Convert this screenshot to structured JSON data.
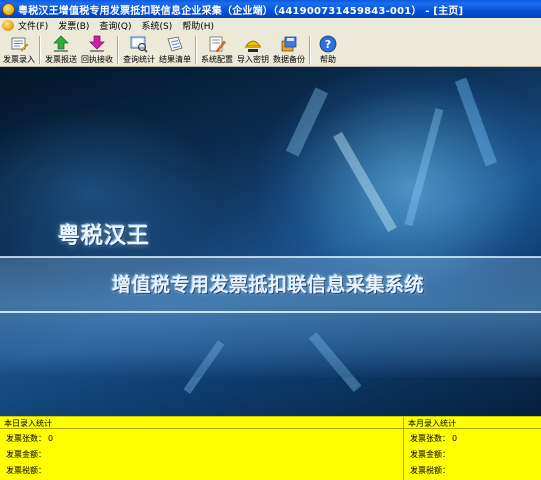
{
  "window": {
    "title": "粤税汉王增值税专用发票抵扣联信息企业采集（企业端）（441900731459843-001） - [主页]"
  },
  "menu": [
    {
      "label": "文件(F)"
    },
    {
      "label": "发票(B)"
    },
    {
      "label": "查询(Q)"
    },
    {
      "label": "系统(S)"
    },
    {
      "label": "帮助(H)"
    }
  ],
  "toolbar": [
    {
      "label": "发票录入",
      "icon": "invoice-entry-icon"
    },
    {
      "label": "发票报送",
      "icon": "upload-arrow-icon"
    },
    {
      "label": "回执接收",
      "icon": "download-arrow-icon"
    },
    {
      "label": "查询统计",
      "icon": "query-stats-icon"
    },
    {
      "label": "结果清单",
      "icon": "result-list-icon"
    },
    {
      "label": "系统配置",
      "icon": "system-config-icon"
    },
    {
      "label": "导入密钥",
      "icon": "import-key-icon"
    },
    {
      "label": "数据备份",
      "icon": "data-backup-icon"
    },
    {
      "label": "帮助",
      "icon": "help-icon"
    }
  ],
  "banner": {
    "brand": "粤税汉王",
    "subtitle": "增值税专用发票抵扣联信息采集系统"
  },
  "stats": {
    "daily": {
      "title": "本日录入统计",
      "count_label": "发票张数：",
      "count_value": "0",
      "amount_label": "发票金额：",
      "amount_value": "",
      "tax_label": "发票税额：",
      "tax_value": ""
    },
    "monthly": {
      "title": "本月录入统计",
      "count_label": "发票张数：",
      "count_value": "0",
      "amount_label": "发票金额：",
      "amount_value": "",
      "tax_label": "发票税额：",
      "tax_value": ""
    }
  },
  "colors": {
    "titlebar": "#0552d8",
    "stats_background": "#ffff00",
    "chrome": "#ece9d8"
  }
}
